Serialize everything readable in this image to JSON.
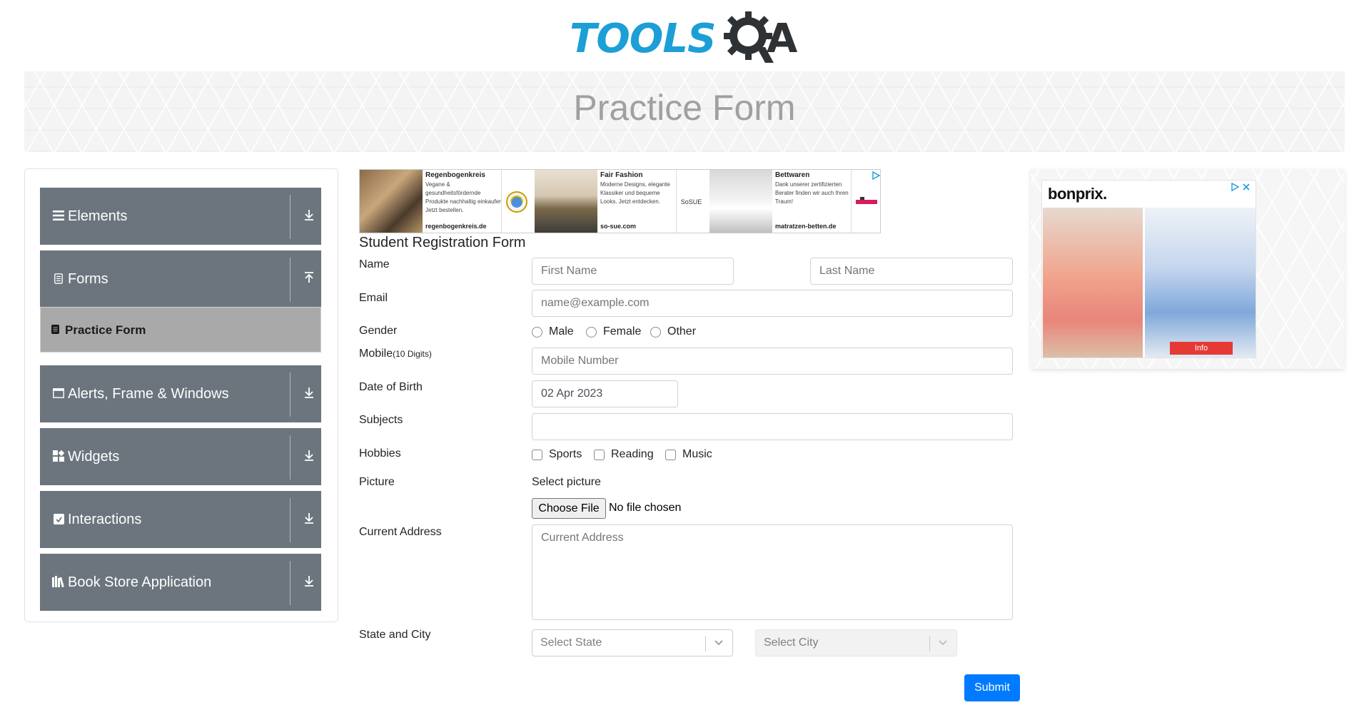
{
  "header": {
    "logo_text_tools": "TOOLS",
    "logo_text_qa": "A",
    "banner_title": "Practice Form"
  },
  "sidebar": {
    "groups": [
      {
        "label": "Elements",
        "icon": "list-icon",
        "toggle": "download-arrow-icon"
      },
      {
        "label": "Forms",
        "icon": "document-icon",
        "toggle": "upload-arrow-icon"
      },
      {
        "label": "Alerts, Frame & Windows",
        "icon": "window-icon",
        "toggle": "download-arrow-icon"
      },
      {
        "label": "Widgets",
        "icon": "grid-icon",
        "toggle": "download-arrow-icon"
      },
      {
        "label": "Interactions",
        "icon": "interaction-icon",
        "toggle": "download-arrow-icon"
      },
      {
        "label": "Book Store Application",
        "icon": "books-icon",
        "toggle": "download-arrow-icon"
      }
    ],
    "active_item": "Practice Form"
  },
  "ads": {
    "strip": [
      {
        "title": "Regenbogenkreis",
        "body": "Vegane & gesundheitsfördernde Produkte nachhaltig einkaufen. Jetzt bestellen.",
        "url": "regenbogenkreis.de"
      },
      {
        "title": "Fair Fashion",
        "body": "Moderne Designs, elegante Klassiker und bequeme Looks. Jetzt entdecken.",
        "url": "so-sue.com",
        "logo": "SoSUE"
      },
      {
        "title": "Bettwaren",
        "body": "Dank unserer zertifizierten Berater finden wir auch Ihren Traum!",
        "url": "matratzen-betten.de"
      }
    ],
    "right": {
      "brand": "bonprix.",
      "info": "Info"
    }
  },
  "form": {
    "title": "Student Registration Form",
    "labels": {
      "name": "Name",
      "email": "Email",
      "gender": "Gender",
      "mobile": "Mobile",
      "mobile_hint": "(10 Digits)",
      "dob": "Date of Birth",
      "subjects": "Subjects",
      "hobbies": "Hobbies",
      "picture": "Picture",
      "address": "Current Address",
      "state_city": "State and City"
    },
    "placeholders": {
      "first_name": "First Name",
      "last_name": "Last Name",
      "email": "name@example.com",
      "mobile": "Mobile Number",
      "address": "Current Address"
    },
    "values": {
      "dob": "02 Apr 2023",
      "subjects": ""
    },
    "gender_options": [
      "Male",
      "Female",
      "Other"
    ],
    "hobby_options": [
      "Sports",
      "Reading",
      "Music"
    ],
    "picture": {
      "select_label": "Select picture",
      "button": "Choose File",
      "status": "No file chosen"
    },
    "state_placeholder": "Select State",
    "city_placeholder": "Select City",
    "submit": "Submit"
  }
}
